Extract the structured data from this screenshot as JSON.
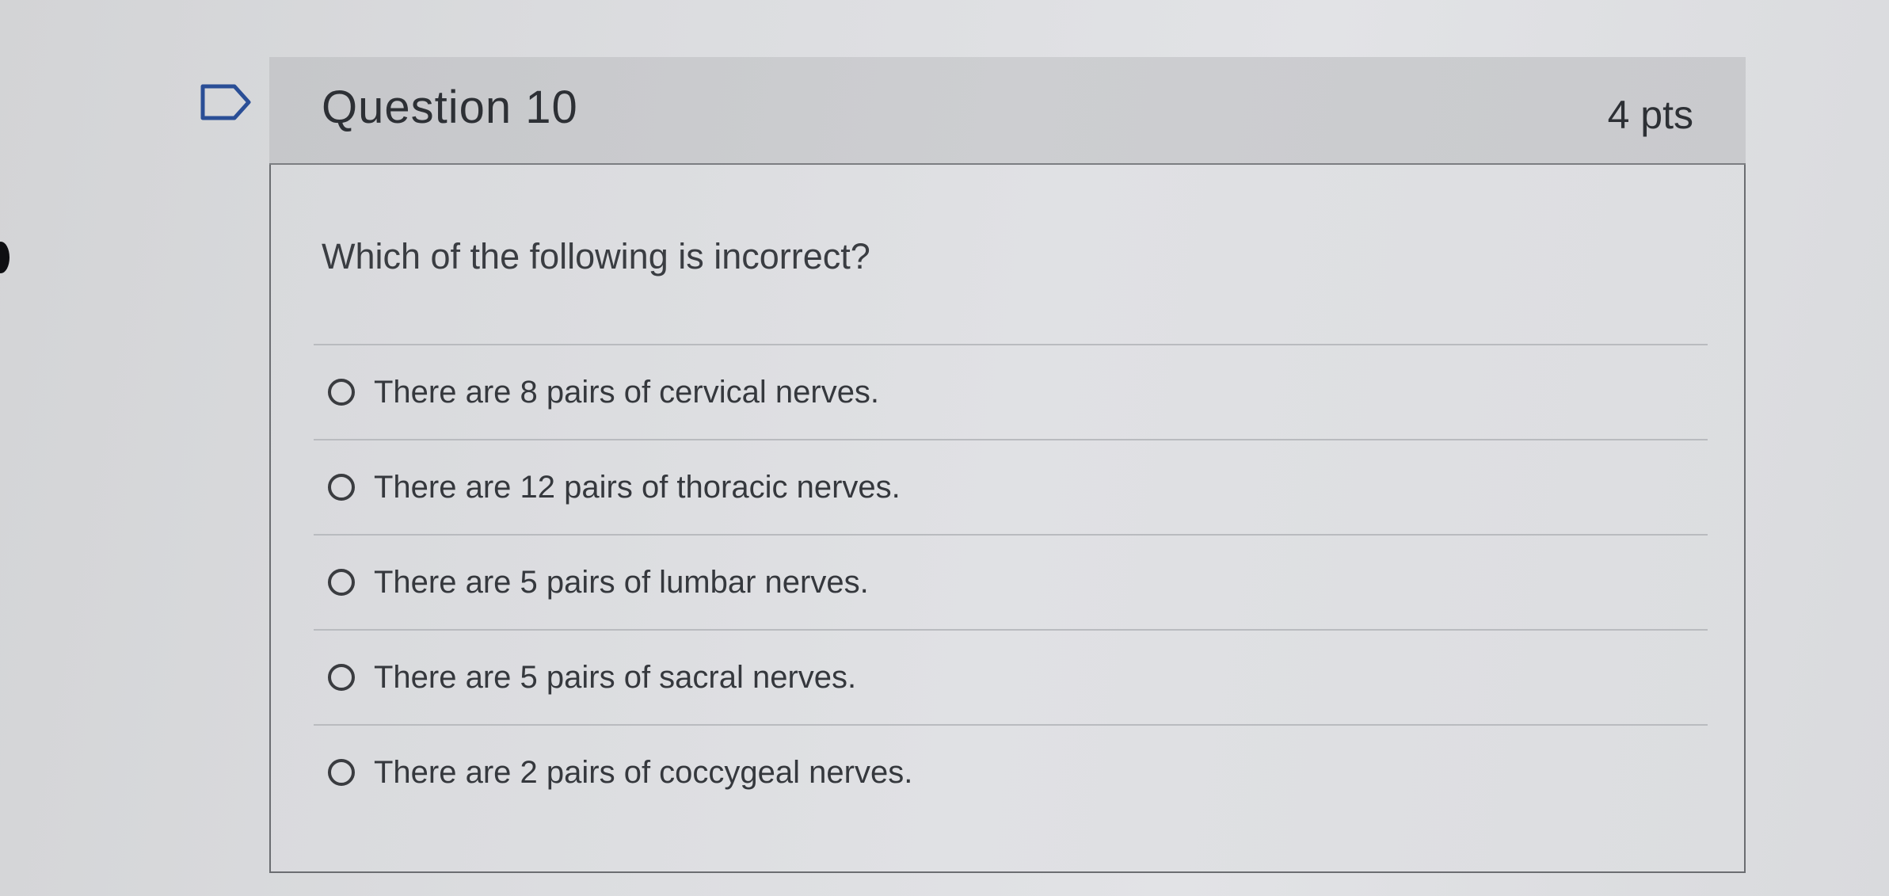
{
  "question": {
    "title": "Question 10",
    "points": "4 pts",
    "prompt": "Which of the following is incorrect?",
    "options": [
      {
        "label": "There are 8 pairs of cervical nerves."
      },
      {
        "label": "There are 12 pairs of thoracic nerves."
      },
      {
        "label": "There are 5 pairs of lumbar nerves."
      },
      {
        "label": "There are 5 pairs of sacral nerves."
      },
      {
        "label": "There are 2 pairs of coccygeal nerves."
      }
    ]
  },
  "icons": {
    "flag": "flag-outline-icon",
    "radio": "radio-unchecked-icon"
  },
  "colors": {
    "background": "#dcdde0",
    "header": "#cbccd0",
    "text": "#2d3035",
    "border": "#6b6d71"
  }
}
